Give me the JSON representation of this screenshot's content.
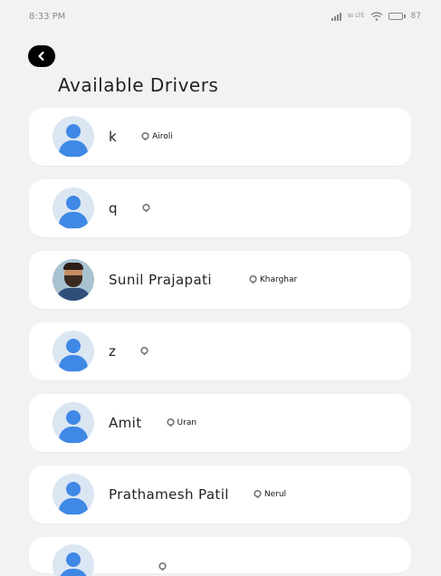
{
  "status_bar": {
    "time": "8:33 PM",
    "network": "Vo LTE",
    "battery": "87",
    "battery_level": 0.87
  },
  "header": {
    "back_icon": "chevron-left-icon",
    "title": "Available Drivers"
  },
  "drivers": [
    {
      "name": "k",
      "location": "Airoli",
      "avatar": "default-avatar-icon"
    },
    {
      "name": "q",
      "location": "",
      "avatar": "default-avatar-icon"
    },
    {
      "name": "Sunil Prajapati",
      "location": "Kharghar",
      "avatar": "profile-photo"
    },
    {
      "name": "z",
      "location": "",
      "avatar": "default-avatar-icon"
    },
    {
      "name": "Amit",
      "location": "Uran",
      "avatar": "default-avatar-icon"
    },
    {
      "name": "Prathamesh Patil",
      "location": "Nerul",
      "avatar": "default-avatar-icon"
    }
  ],
  "colors": {
    "background": "#f2f2f4",
    "card": "#ffffff",
    "avatar_bg": "#dbe6f3",
    "avatar_fg": "#3f88e5",
    "back_button": "#000000"
  }
}
